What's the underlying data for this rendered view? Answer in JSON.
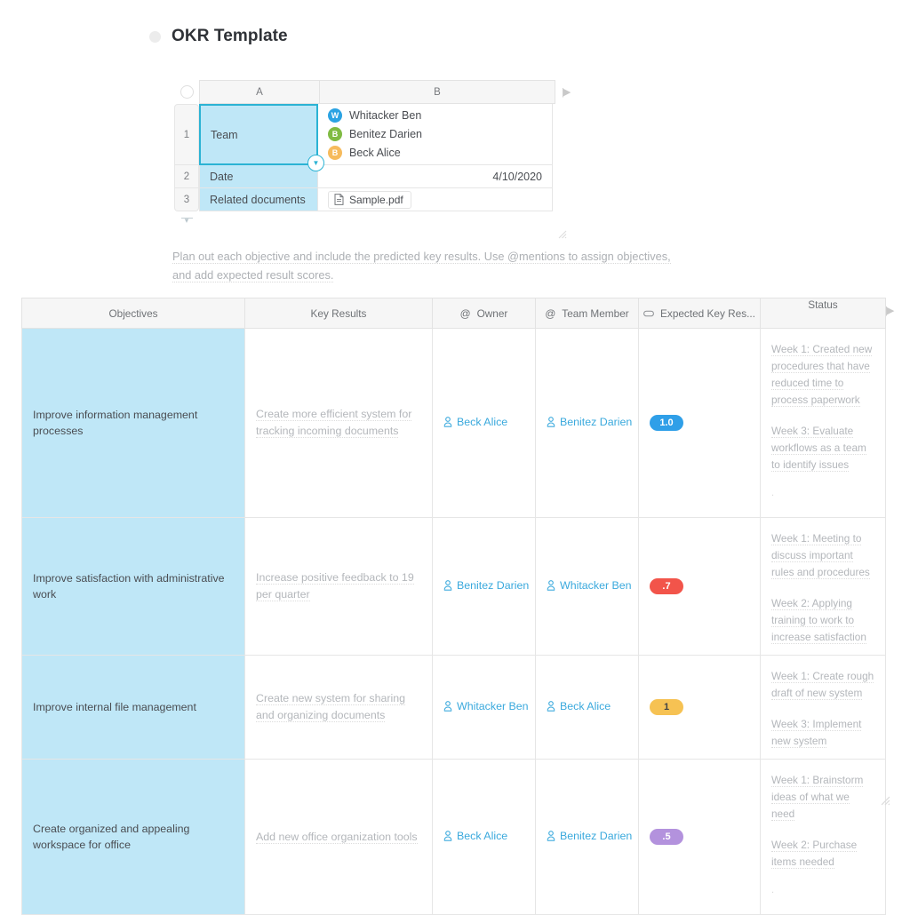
{
  "page": {
    "title": "OKR Template",
    "bullet_icon": "circle-bullet-icon"
  },
  "info_sheet": {
    "column_headers": [
      "A",
      "B"
    ],
    "row_numbers": [
      "1",
      "2",
      "3"
    ],
    "rows": [
      {
        "label": "Team",
        "type": "members",
        "members": [
          {
            "initial": "W",
            "name": "Whitacker Ben",
            "color": "#2ba3e3"
          },
          {
            "initial": "B",
            "name": "Benitez Darien",
            "color": "#80bb43"
          },
          {
            "initial": "B",
            "name": "Beck Alice",
            "color": "#f6bb5d"
          }
        ]
      },
      {
        "label": "Date",
        "type": "date",
        "value": "4/10/2020"
      },
      {
        "label": "Related documents",
        "type": "file",
        "file_name": "Sample.pdf"
      }
    ],
    "selected_cell": "Team",
    "expand_icon": "expand-columns-icon",
    "resize_grip_icon": "resize-grip-icon",
    "row_handle_icon": "row-drag-handle-icon",
    "cell_dropdown_icon": "cell-dropdown-icon"
  },
  "description": {
    "line1": "Plan out each objective and include the predicted key results. Use @mentions to assign objectives,",
    "line2": "and add expected result scores."
  },
  "okr_table": {
    "headers": [
      {
        "label": "Objectives",
        "icon": null
      },
      {
        "label": "Key Results",
        "icon": null
      },
      {
        "label": "Owner",
        "icon": "at-mention-icon"
      },
      {
        "label": "Team Member",
        "icon": "at-mention-icon"
      },
      {
        "label": "Expected Key Res...",
        "icon": "label-pill-icon"
      },
      {
        "label": "Status",
        "icon": null
      }
    ],
    "expand_icon": "expand-columns-icon",
    "resize_grip_icon": "resize-grip-icon",
    "rows": [
      {
        "objective": "Improve information management processes",
        "key_result": "Create more efficient system for tracking incoming documents",
        "owner": "Beck Alice",
        "team_member": "Benitez Darien",
        "expected_score": "1.0",
        "score_color": "#2f9fe8",
        "score_text_dark": false,
        "status": [
          "Week 1: Created new procedures that have reduced time to process paperwork",
          "Week 3: Evaluate workflows as a team to identify issues"
        ],
        "status_tail": "."
      },
      {
        "objective": "Improve satisfaction with administrative work",
        "key_result": "Increase positive feedback to 19 per quarter",
        "owner": "Benitez Darien",
        "team_member": "Whitacker Ben",
        "expected_score": ".7",
        "score_color": "#f2544a",
        "score_text_dark": false,
        "status": [
          "Week 1: Meeting to discuss important rules and procedures",
          "Week 2: Applying training to work to increase satisfaction"
        ],
        "status_tail": ""
      },
      {
        "objective": "Improve internal file management",
        "key_result": "Create new system for sharing and organizing documents",
        "owner": "Whitacker Ben",
        "team_member": "Beck Alice",
        "expected_score": "1",
        "score_color": "#f6c253",
        "score_text_dark": true,
        "status": [
          "Week 1: Create rough draft of new system",
          "Week 3: Implement new system"
        ],
        "status_tail": ""
      },
      {
        "objective": "Create organized and appealing workspace for office",
        "key_result": "Add new office organization tools",
        "owner": "Beck Alice",
        "team_member": "Benitez Darien",
        "expected_score": ".5",
        "score_color": "#b392dd",
        "score_text_dark": false,
        "status": [
          "Week 1: Brainstorm ideas of what we need",
          "Week 2: Purchase items needed"
        ],
        "status_tail": "."
      }
    ]
  },
  "colors": {
    "objective_cell_bg": "#bfe7f7",
    "selection_border": "#2bb3d4",
    "link_blue": "#3aa9dd",
    "muted_text": "#b4b7bb"
  }
}
